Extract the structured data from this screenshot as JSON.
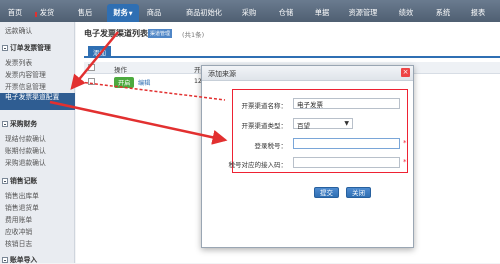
{
  "topnav": {
    "tabs": [
      {
        "label": "首页"
      },
      {
        "label": "发货"
      },
      {
        "label": "售后"
      },
      {
        "label": "财务"
      },
      {
        "label": "商品"
      },
      {
        "label": "商品初始化"
      },
      {
        "label": "采购"
      },
      {
        "label": "仓储"
      },
      {
        "label": "单据"
      },
      {
        "label": "资源管理"
      },
      {
        "label": "绩效"
      },
      {
        "label": "系统"
      },
      {
        "label": "报表"
      }
    ],
    "active_tab": "财务"
  },
  "sidebar": {
    "top_item": "远款确认",
    "groups": [
      {
        "title": "订单发票管理",
        "items": [
          "发票列表",
          "发票内容管理",
          "开票信息管理",
          "电子发票渠道配置"
        ]
      },
      {
        "title": "采购财务",
        "items": [
          "现结付款确认",
          "账期付款确认",
          "采购退款确认"
        ]
      },
      {
        "title": "销售记账",
        "items": [
          "销售出库单",
          "销售退货单",
          "费用账单",
          "应收冲销",
          "核销日志"
        ]
      },
      {
        "title": "账单导入",
        "items": []
      }
    ],
    "selected_item": "电子发票渠道配置"
  },
  "content": {
    "title": "电子发票渠道列表",
    "tag": "渠道管理",
    "count_text": "(共1条)",
    "add_tab": "添加",
    "columns": [
      "操作",
      "开票"
    ],
    "rows": [
      {
        "status": "开启",
        "action": "编辑",
        "code": "12"
      }
    ]
  },
  "dialog": {
    "title": "添加来源",
    "close": "×",
    "fields": [
      {
        "label": "开票渠道名称：",
        "value": "电子发票",
        "required": false
      },
      {
        "label": "开票渠道类型：",
        "value": "百望",
        "required": false
      },
      {
        "label": "登录税号：",
        "value": "",
        "required": true
      },
      {
        "label": "税号对应的接入码：",
        "value": "",
        "required": true
      }
    ],
    "required_mark": "*",
    "submit_label": "提交",
    "close_label": "关闭"
  },
  "colors": {
    "nav_active": "#2f6fb3",
    "annotation": "#e23030",
    "status_green": "#4caa3e"
  }
}
